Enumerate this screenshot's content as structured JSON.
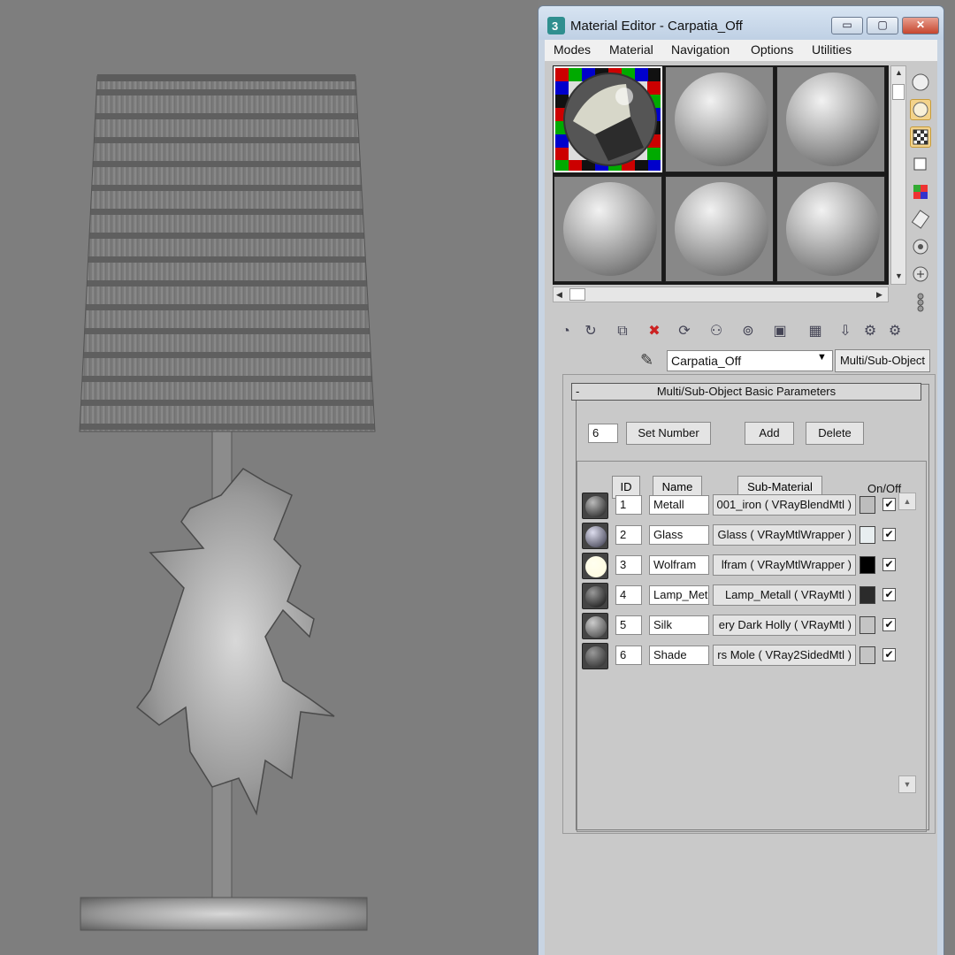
{
  "window": {
    "title": "Material Editor - Carpatia_Off",
    "min_label": "▭",
    "max_label": "▢",
    "close_label": "✕"
  },
  "menubar": {
    "items": [
      "Modes",
      "Material",
      "Navigation",
      "Options",
      "Utilities"
    ]
  },
  "material": {
    "name": "Carpatia_Off",
    "type": "Multi/Sub-Object"
  },
  "rollout": {
    "collapse": "-",
    "title": "Multi/Sub-Object Basic Parameters",
    "count": "6",
    "set_number_label": "Set Number",
    "add_label": "Add",
    "delete_label": "Delete",
    "headers": {
      "id": "ID",
      "name": "Name",
      "submaterial": "Sub-Material",
      "onoff": "On/Off"
    },
    "rows": [
      {
        "id": "1",
        "name": "Metall",
        "submaterial": "001_iron  ( VRayBlendMtl )",
        "swatch": "#bdbdbd",
        "checked": "✔"
      },
      {
        "id": "2",
        "name": "Glass",
        "submaterial": "Glass  ( VRayMtlWrapper )",
        "swatch": "#e8eef0",
        "checked": "✔"
      },
      {
        "id": "3",
        "name": "Wolfram",
        "submaterial": "lfram  ( VRayMtlWrapper )",
        "swatch": "#000000",
        "checked": "✔"
      },
      {
        "id": "4",
        "name": "Lamp_Met",
        "submaterial": "Lamp_Metall  ( VRayMtl )",
        "swatch": "#2b2b2b",
        "checked": "✔"
      },
      {
        "id": "5",
        "name": "Silk",
        "submaterial": "ery Dark Holly  ( VRayMtl )",
        "swatch": "#c4c4c4",
        "checked": "✔"
      },
      {
        "id": "6",
        "name": "Shade",
        "submaterial": "rs Mole  ( VRay2SidedMtl )",
        "swatch": "#c4c4c4",
        "checked": "✔"
      }
    ]
  },
  "colors": {
    "accent": "#f3d38b",
    "window_frame": "#c8d4e2",
    "panel": "#c9c9c9"
  }
}
